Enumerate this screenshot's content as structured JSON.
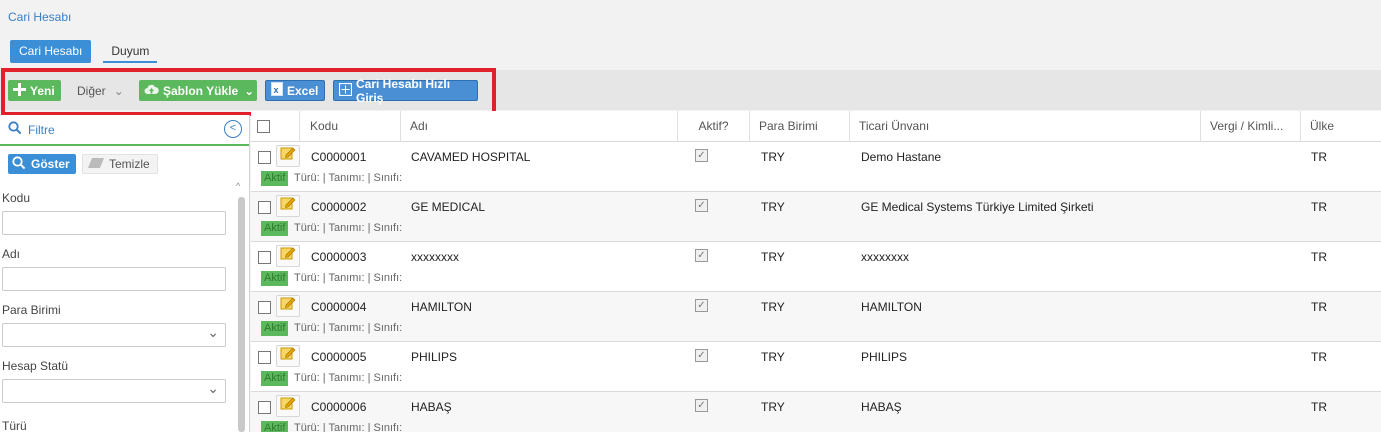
{
  "breadcrumb": "Cari Hesabı",
  "tabs": [
    {
      "label": "Cari Hesabı"
    },
    {
      "label": "Duyum"
    }
  ],
  "toolbar": {
    "new_label": "Yeni",
    "other_label": "Diğer",
    "template_label": "Şablon Yükle",
    "excel_label": "Excel",
    "quick_entry_label": "Cari Hesabı Hızlı Giriş"
  },
  "filter": {
    "title": "Filtre",
    "show_label": "Göster",
    "clear_label": "Temizle",
    "fields": {
      "kodu": "Kodu",
      "adi": "Adı",
      "para_birimi": "Para Birimi",
      "hesap_statu": "Hesap Statü",
      "turu": "Türü"
    }
  },
  "grid": {
    "columns": {
      "kodu": "Kodu",
      "adi": "Adı",
      "aktif": "Aktif?",
      "para_birimi": "Para Birimi",
      "ticari_unvani": "Ticari Ünvanı",
      "vergi": "Vergi / Kimli...",
      "ulke": "Ülke"
    },
    "rows": [
      {
        "kodu": "C0000001",
        "adi": "CAVAMED HOSPITAL",
        "para": "TRY",
        "unvan": "Demo Hastane",
        "ulke": "TR",
        "badge": "Aktif",
        "sub": "Türü: | Tanımı: | Sınıfı:"
      },
      {
        "kodu": "C0000002",
        "adi": "GE MEDICAL",
        "para": "TRY",
        "unvan": "GE Medical Systems Türkiye Limited Şirketi",
        "ulke": "TR",
        "badge": "Aktif",
        "sub": "Türü: | Tanımı: | Sınıfı:"
      },
      {
        "kodu": "C0000003",
        "adi": "xxxxxxxx",
        "para": "TRY",
        "unvan": "xxxxxxxx",
        "ulke": "TR",
        "badge": "Aktif",
        "sub": "Türü: | Tanımı: | Sınıfı:"
      },
      {
        "kodu": "C0000004",
        "adi": "HAMILTON",
        "para": "TRY",
        "unvan": "HAMILTON",
        "ulke": "TR",
        "badge": "Aktif",
        "sub": "Türü: | Tanımı: | Sınıfı:"
      },
      {
        "kodu": "C0000005",
        "adi": "PHILIPS",
        "para": "TRY",
        "unvan": "PHILIPS",
        "ulke": "TR",
        "badge": "Aktif",
        "sub": "Türü: | Tanımı: | Sınıfı:"
      },
      {
        "kodu": "C0000006",
        "adi": "HABAŞ",
        "para": "TRY",
        "unvan": "HABAŞ",
        "ulke": "TR",
        "badge": "Aktif",
        "sub": "Türü: | Tanımı: | Sınıfı:"
      }
    ]
  },
  "colors": {
    "accent_blue": "#3b8fd6",
    "accent_green": "#5cb85c",
    "highlight_red": "#e0202a"
  }
}
